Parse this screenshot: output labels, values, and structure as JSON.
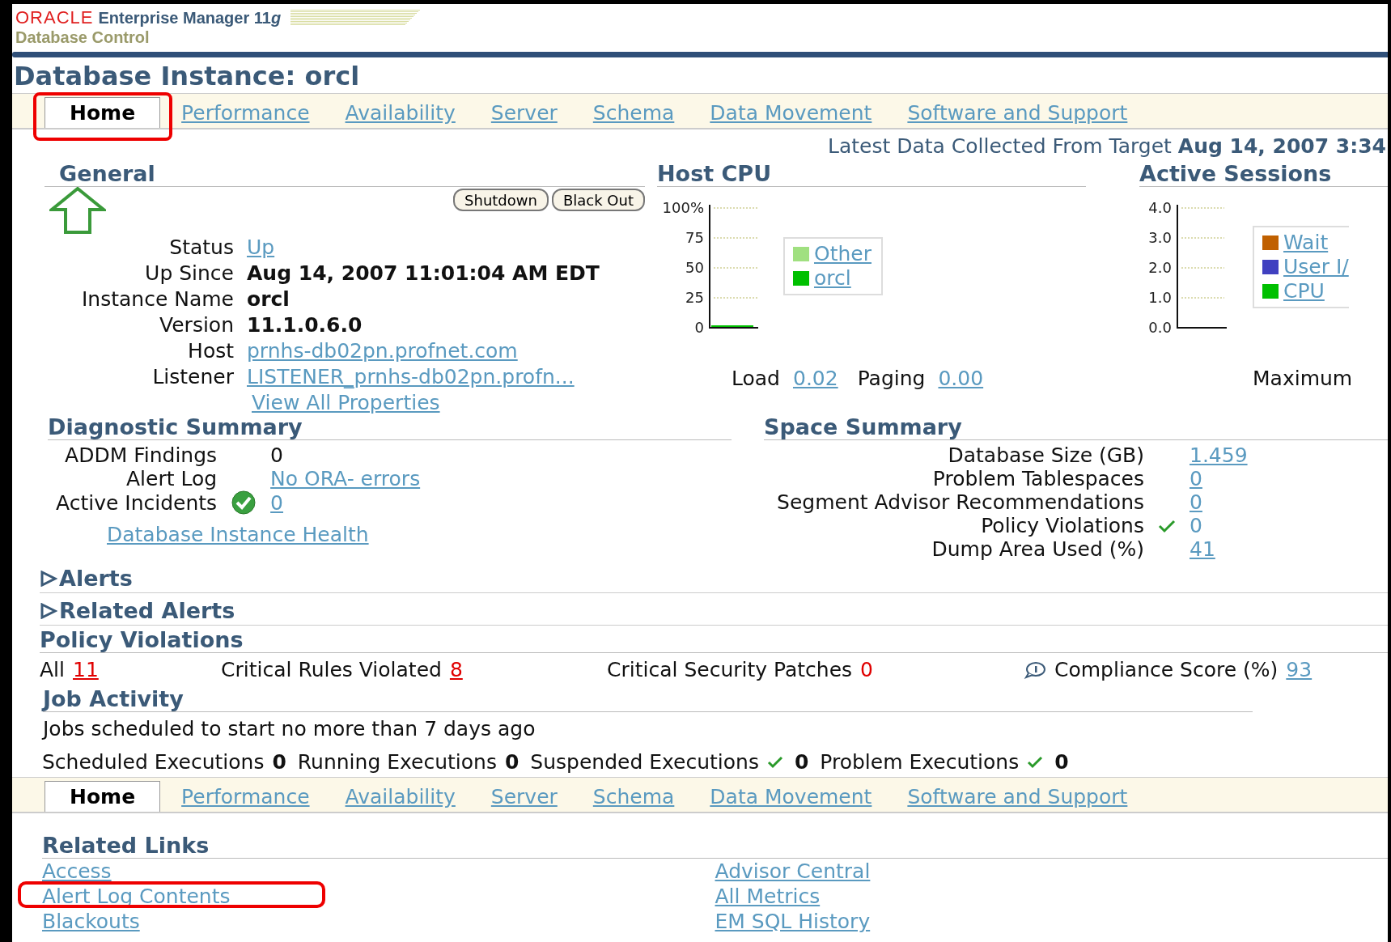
{
  "header": {
    "brand": "ORACLE",
    "product": "Enterprise Manager 11",
    "product_suffix": "g",
    "subtitle": "Database Control"
  },
  "page_title": "Database Instance: orcl",
  "tabs": [
    {
      "label": "Home",
      "selected": true
    },
    {
      "label": "Performance",
      "selected": false
    },
    {
      "label": "Availability",
      "selected": false
    },
    {
      "label": "Server",
      "selected": false
    },
    {
      "label": "Schema",
      "selected": false
    },
    {
      "label": "Data Movement",
      "selected": false
    },
    {
      "label": "Software and Support",
      "selected": false
    }
  ],
  "latest_data": {
    "label": "Latest Data Collected From Target",
    "value": "Aug 14, 2007 3:34"
  },
  "general": {
    "title": "General",
    "status_up": true,
    "buttons": [
      "Shutdown",
      "Black Out"
    ],
    "fields": [
      {
        "label": "Status",
        "value": "Up",
        "kind": "link"
      },
      {
        "label": "Up Since",
        "value": "Aug 14, 2007 11:01:04 AM EDT",
        "kind": "bold"
      },
      {
        "label": "Instance Name",
        "value": "orcl",
        "kind": "bold"
      },
      {
        "label": "Version",
        "value": "11.1.0.6.0",
        "kind": "bold"
      },
      {
        "label": "Host",
        "value": "prnhs-db02pn.profnet.com",
        "kind": "link"
      },
      {
        "label": "Listener",
        "value": "LISTENER_prnhs-db02pn.profn...",
        "kind": "link"
      }
    ],
    "view_all": "View All Properties"
  },
  "host_cpu": {
    "title": "Host CPU",
    "axis_labels": [
      "100%",
      "75",
      "50",
      "25",
      "0"
    ],
    "legend": [
      {
        "name": "Other",
        "color": "#a0e080"
      },
      {
        "name": "orcl",
        "color": "#00c000"
      }
    ],
    "stats": [
      {
        "label": "Load",
        "value": "0.02"
      },
      {
        "label": "Paging",
        "value": "0.00"
      }
    ]
  },
  "active_sessions": {
    "title": "Active Sessions",
    "axis_labels": [
      "4.0",
      "3.0",
      "2.0",
      "1.0",
      "0.0"
    ],
    "legend": [
      {
        "name": "Wait",
        "color": "#c06000"
      },
      {
        "name": "User I/",
        "color": "#4040c0"
      },
      {
        "name": "CPU",
        "color": "#00c000"
      }
    ],
    "footer_label": "Maximum"
  },
  "diagnostic_summary": {
    "title": "Diagnostic Summary",
    "rows": [
      {
        "label": "ADDM Findings",
        "value": "0",
        "kind": "plain",
        "ok": false
      },
      {
        "label": "Alert Log",
        "value": "No ORA- errors",
        "kind": "link",
        "ok": false
      },
      {
        "label": "Active Incidents",
        "value": "0",
        "kind": "link",
        "ok": true
      }
    ],
    "health_link": "Database Instance Health"
  },
  "space_summary": {
    "title": "Space Summary",
    "rows": [
      {
        "label": "Database Size (GB)",
        "value": "1.459",
        "kind": "link",
        "ok": false
      },
      {
        "label": "Problem Tablespaces",
        "value": "0",
        "kind": "link",
        "ok": false
      },
      {
        "label": "Segment Advisor Recommendations",
        "value": "0",
        "kind": "link",
        "ok": false
      },
      {
        "label": "Policy Violations",
        "value": "0",
        "kind": "plain",
        "ok": true
      },
      {
        "label": "Dump Area Used (%)",
        "value": "41",
        "kind": "link",
        "ok": false
      }
    ]
  },
  "collapsed_sections": [
    {
      "title": "Alerts",
      "expanded": false
    },
    {
      "title": "Related Alerts",
      "expanded": false
    }
  ],
  "policy_violations": {
    "title": "Policy Violations",
    "items": [
      {
        "label": "All",
        "value": "11",
        "kind": "critical"
      },
      {
        "label": "Critical Rules Violated",
        "value": "8",
        "kind": "critical"
      },
      {
        "label": "Critical Security Patches",
        "value": "0",
        "kind": "zero"
      },
      {
        "label": "Compliance Score (%)",
        "value": "93",
        "kind": "score"
      }
    ]
  },
  "job_activity": {
    "title": "Job Activity",
    "note": "Jobs scheduled to start no more than 7 days ago",
    "items": [
      {
        "label": "Scheduled Executions",
        "value": "0",
        "ok": false
      },
      {
        "label": "Running Executions",
        "value": "0",
        "ok": false
      },
      {
        "label": "Suspended Executions",
        "value": "0",
        "ok": true
      },
      {
        "label": "Problem Executions",
        "value": "0",
        "ok": true
      }
    ]
  },
  "bottom_tabs": [
    {
      "label": "Home",
      "selected": true
    },
    {
      "label": "Performance",
      "selected": false
    },
    {
      "label": "Availability",
      "selected": false
    },
    {
      "label": "Server",
      "selected": false
    },
    {
      "label": "Schema",
      "selected": false
    },
    {
      "label": "Data Movement",
      "selected": false
    },
    {
      "label": "Software and Support",
      "selected": false
    }
  ],
  "related_links": {
    "title": "Related Links",
    "columns": [
      [
        "Access",
        "Alert Log Contents",
        "Blackouts"
      ],
      [
        "Advisor Central",
        "All Metrics",
        "EM SQL History"
      ]
    ]
  }
}
